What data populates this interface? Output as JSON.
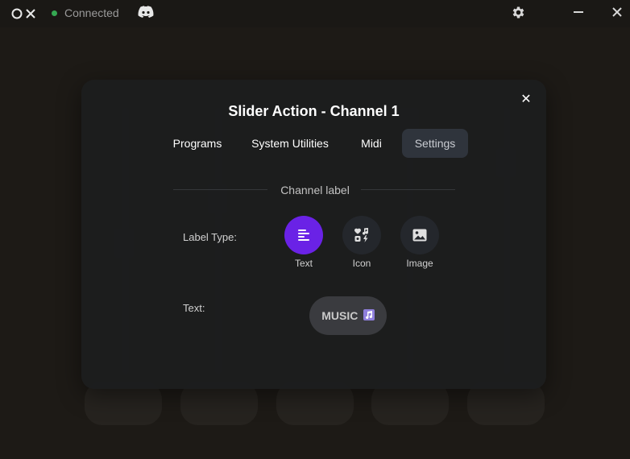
{
  "titlebar": {
    "status": "Connected",
    "colors": {
      "status_dot": "#35a852"
    }
  },
  "modal": {
    "title": "Slider Action - Channel 1",
    "close_glyph": "✕",
    "tabs": [
      {
        "label": "Programs",
        "active": false
      },
      {
        "label": "System Utilities",
        "active": false
      },
      {
        "label": "Midi",
        "active": false
      },
      {
        "label": "Settings",
        "active": true
      }
    ],
    "section_label": "Channel label",
    "label_type": {
      "label": "Label Type:",
      "options": [
        {
          "label": "Text",
          "icon": "text-align-icon",
          "selected": true
        },
        {
          "label": "Icon",
          "icon": "icon-shapes-icon",
          "selected": false
        },
        {
          "label": "Image",
          "icon": "image-icon",
          "selected": false
        }
      ]
    },
    "text_field": {
      "label": "Text:",
      "value": "MUSIC",
      "emoji": "music-note-icon"
    },
    "colors": {
      "accent": "#6a22e6",
      "active_tab_bg": "#2f343c"
    }
  }
}
